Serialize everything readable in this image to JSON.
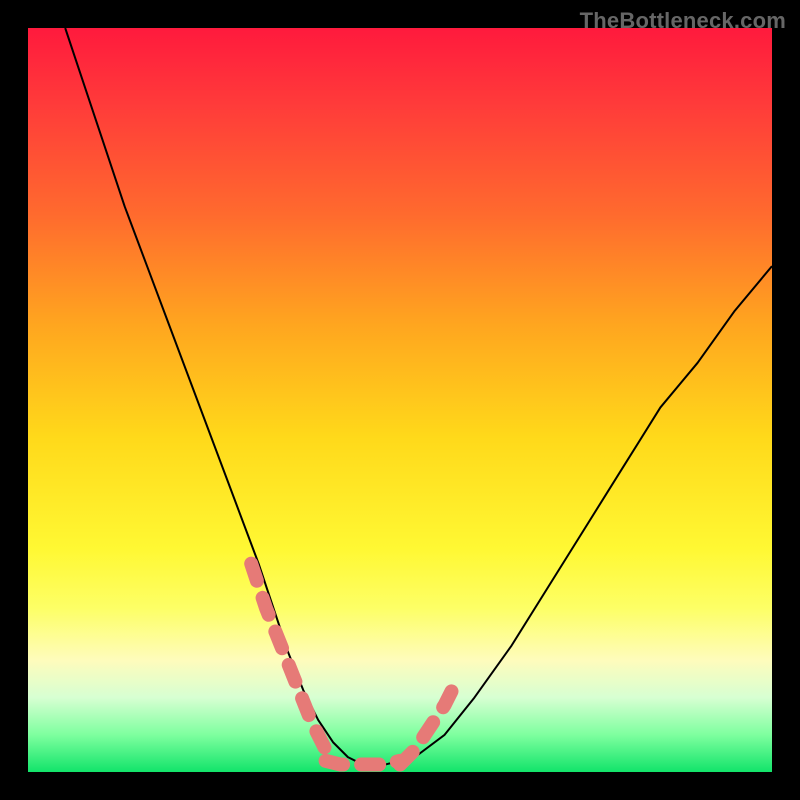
{
  "watermark": "TheBottleneck.com",
  "chart_data": {
    "type": "line",
    "title": "",
    "xlabel": "",
    "ylabel": "",
    "xlim": [
      0,
      100
    ],
    "ylim": [
      0,
      100
    ],
    "grid": false,
    "legend": false,
    "series": [
      {
        "name": "bottleneck-curve",
        "color": "#000000",
        "x": [
          5,
          7,
          10,
          13,
          16,
          19,
          22,
          25,
          28,
          31,
          33,
          35,
          37,
          39,
          41,
          43,
          45,
          48,
          52,
          56,
          60,
          65,
          70,
          75,
          80,
          85,
          90,
          95,
          100
        ],
        "y": [
          100,
          94,
          85,
          76,
          68,
          60,
          52,
          44,
          36,
          28,
          22,
          16,
          11,
          7,
          4,
          2,
          1,
          1,
          2,
          5,
          10,
          17,
          25,
          33,
          41,
          49,
          55,
          62,
          68
        ]
      },
      {
        "name": "left-highlight",
        "color": "#e67a77",
        "style": "dashed-thick",
        "x": [
          30,
          32,
          34,
          36,
          38,
          40
        ],
        "y": [
          28,
          22,
          17,
          12,
          7,
          3
        ]
      },
      {
        "name": "right-highlight",
        "color": "#e67a77",
        "style": "dashed-thick",
        "x": [
          50,
          52,
          54,
          56,
          58
        ],
        "y": [
          1,
          3,
          6,
          9,
          13
        ]
      },
      {
        "name": "bottom-highlight",
        "color": "#e67a77",
        "style": "dashed-thick",
        "x": [
          40,
          42,
          44,
          46,
          48,
          50
        ],
        "y": [
          1.5,
          1,
          1,
          1,
          1,
          1.5
        ]
      }
    ]
  }
}
